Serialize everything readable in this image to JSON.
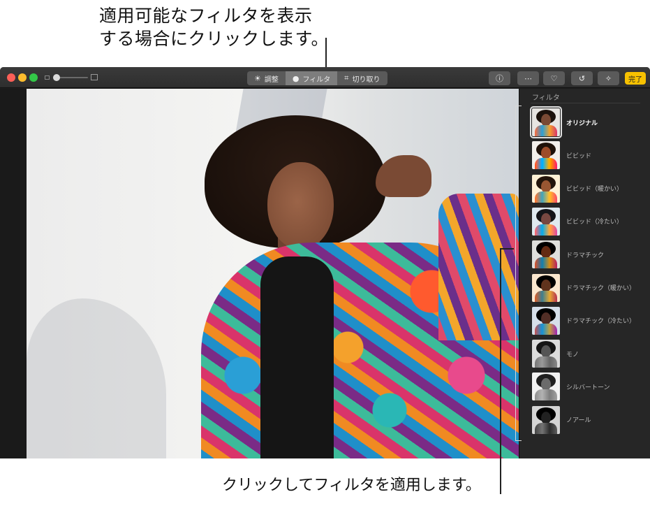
{
  "callouts": {
    "top_line1": "適用可能なフィルタを表示",
    "top_line2": "する場合にクリックします。",
    "bottom": "クリックしてフィルタを適用します。"
  },
  "toolbar": {
    "segments": [
      {
        "label": "調整",
        "icon": "sun-icon",
        "active": false
      },
      {
        "label": "フィルタ",
        "icon": "filter-icon",
        "active": true
      },
      {
        "label": "切り取り",
        "icon": "crop-icon",
        "active": false
      }
    ],
    "done_label": "完了",
    "accent": "#f7c100"
  },
  "sidebar": {
    "title": "フィルタ",
    "filters": [
      {
        "label": "オリジナル",
        "selected": true,
        "tone": "original"
      },
      {
        "label": "ビビッド",
        "selected": false,
        "tone": "vivid"
      },
      {
        "label": "ビビッド（暖かい）",
        "selected": false,
        "tone": "warm"
      },
      {
        "label": "ビビッド（冷たい）",
        "selected": false,
        "tone": "cool"
      },
      {
        "label": "ドラマチック",
        "selected": false,
        "tone": "dramatic"
      },
      {
        "label": "ドラマチック（暖かい）",
        "selected": false,
        "tone": "dramatic-warm"
      },
      {
        "label": "ドラマチック（冷たい）",
        "selected": false,
        "tone": "dramatic-cool"
      },
      {
        "label": "モノ",
        "selected": false,
        "tone": "mono"
      },
      {
        "label": "シルバートーン",
        "selected": false,
        "tone": "silver"
      },
      {
        "label": "ノアール",
        "selected": false,
        "tone": "noir"
      }
    ]
  }
}
